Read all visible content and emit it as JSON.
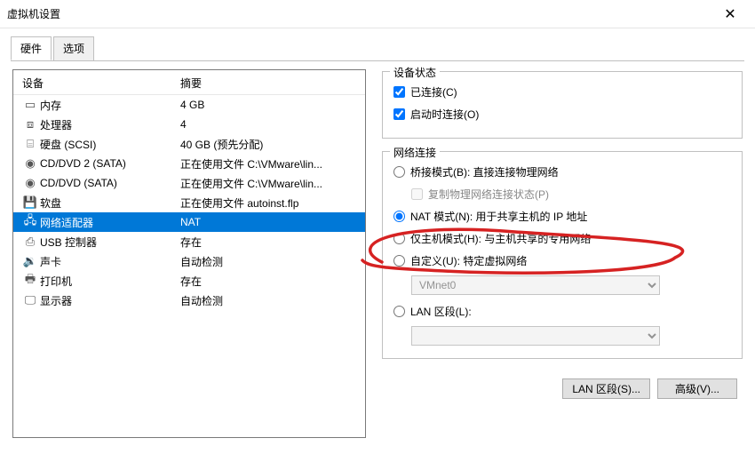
{
  "window": {
    "title": "虚拟机设置"
  },
  "tabs": {
    "hardware": "硬件",
    "options": "选项"
  },
  "list": {
    "col_device": "设备",
    "col_summary": "摘要",
    "rows": [
      {
        "icon": "memory-icon",
        "name": "内存",
        "summary": "4 GB"
      },
      {
        "icon": "cpu-icon",
        "name": "处理器",
        "summary": "4"
      },
      {
        "icon": "disk-icon",
        "name": "硬盘 (SCSI)",
        "summary": "40 GB (预先分配)"
      },
      {
        "icon": "cd-icon",
        "name": "CD/DVD 2 (SATA)",
        "summary": "正在使用文件 C:\\VMware\\lin..."
      },
      {
        "icon": "cd-icon",
        "name": "CD/DVD (SATA)",
        "summary": "正在使用文件 C:\\VMware\\lin..."
      },
      {
        "icon": "floppy-icon",
        "name": "软盘",
        "summary": "正在使用文件 autoinst.flp"
      },
      {
        "icon": "network-icon",
        "name": "网络适配器",
        "summary": "NAT",
        "selected": true
      },
      {
        "icon": "usb-icon",
        "name": "USB 控制器",
        "summary": "存在"
      },
      {
        "icon": "sound-icon",
        "name": "声卡",
        "summary": "自动检测"
      },
      {
        "icon": "printer-icon",
        "name": "打印机",
        "summary": "存在"
      },
      {
        "icon": "display-icon",
        "name": "显示器",
        "summary": "自动检测"
      }
    ]
  },
  "device_state": {
    "legend": "设备状态",
    "connected": "已连接(C)",
    "connect_at_power": "启动时连接(O)"
  },
  "network": {
    "legend": "网络连接",
    "bridged": "桥接模式(B): 直接连接物理网络",
    "replicate": "复制物理网络连接状态(P)",
    "nat": "NAT 模式(N): 用于共享主机的 IP 地址",
    "hostonly": "仅主机模式(H): 与主机共享的专用网络",
    "custom": "自定义(U): 特定虚拟网络",
    "vmnet_value": "VMnet0",
    "lanseg": "LAN 区段(L):",
    "lanseg_value": ""
  },
  "buttons": {
    "lan_segments": "LAN 区段(S)...",
    "advanced": "高级(V)..."
  },
  "icons": {
    "memory-icon": "▭",
    "cpu-icon": "⧈",
    "disk-icon": "⌸",
    "cd-icon": "◉",
    "floppy-icon": "💾",
    "network-icon": "🖧",
    "usb-icon": "⎙",
    "sound-icon": "🔉",
    "printer-icon": "🖶",
    "display-icon": "🖵"
  }
}
